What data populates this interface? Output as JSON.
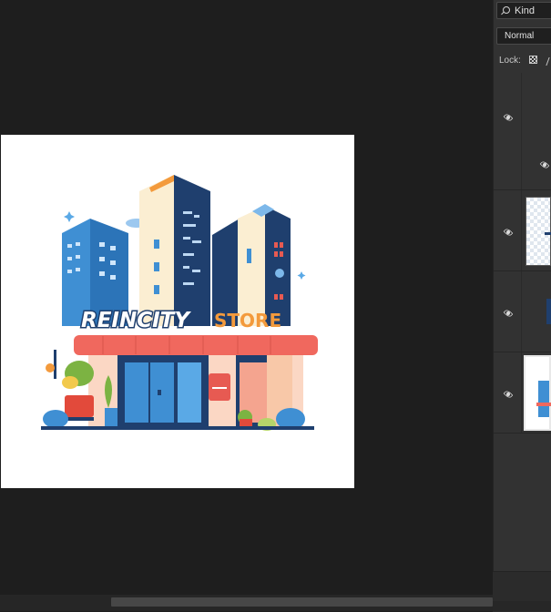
{
  "layers_panel": {
    "filter": {
      "label": "Kind",
      "icon": "search-icon"
    },
    "blend_mode": {
      "value": "Normal"
    },
    "lock": {
      "label": "Lock:",
      "icons": [
        "lock-transparent-pixels-icon",
        "lock-image-pixels-icon"
      ]
    },
    "layers": [
      {
        "type": "group",
        "visible": true
      },
      {
        "type": "text-logo",
        "visible": true
      },
      {
        "type": "shape",
        "visible": true
      },
      {
        "type": "image",
        "visible": true,
        "selected": true
      }
    ]
  },
  "document": {
    "logo": {
      "word1": "REINCITY",
      "word2": "STORE"
    }
  },
  "colors": {
    "workspace": "#1e1e1e",
    "panel": "#323232",
    "building_dark": "#1f3f6e",
    "building_blue": "#3f8fd3",
    "building_cream": "#fbeed2",
    "awning": "#f0685e",
    "store_text_orange": "#f39a3c"
  }
}
